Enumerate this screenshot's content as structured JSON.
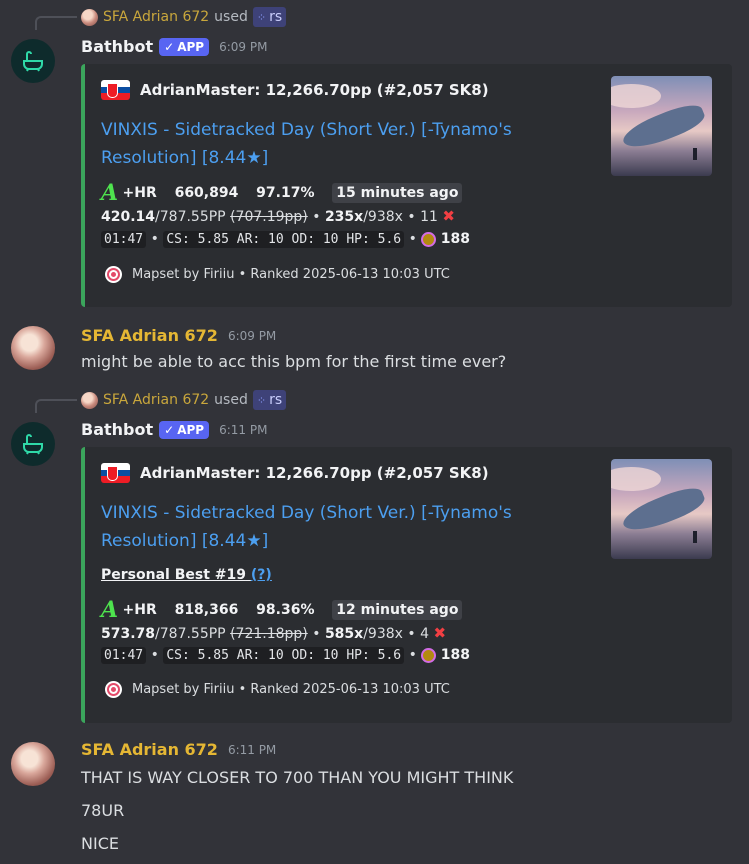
{
  "messages": [
    {
      "reply": {
        "user": "SFA Adrian 672",
        "used": "used",
        "command": "rs"
      },
      "bot": {
        "name": "Bathbot",
        "badge": "APP",
        "time": "6:09 PM"
      },
      "embed": {
        "author": "AdrianMaster: 12,266.70pp (#2,057 SK8)",
        "title": "VINXIS - Sidetracked Day (Short Ver.) [-Tynamo's Resolution] [8.44★]",
        "grade": "A",
        "mods": "+HR",
        "score": "660,894",
        "accuracy": "97.17%",
        "time_ago": "15 minutes ago",
        "pp": "420.14",
        "pp_max": "/787.55PP",
        "pp_fc": "(707.19pp)",
        "combo": "235x",
        "combo_max": "/938x",
        "misses": "11",
        "length": "01:47",
        "map_stats": "CS: 5.85 AR: 10 OD: 10 HP: 5.6",
        "bpm": "188",
        "footer": "Mapset by Firiiu • Ranked 2025-06-13 10:03 UTC"
      }
    },
    {
      "user": {
        "name": "SFA Adrian 672",
        "time": "6:09 PM"
      },
      "lines": [
        "might be able to acc this bpm for the first time ever?"
      ]
    },
    {
      "reply": {
        "user": "SFA Adrian 672",
        "used": "used",
        "command": "rs"
      },
      "bot": {
        "name": "Bathbot",
        "badge": "APP",
        "time": "6:11 PM"
      },
      "embed": {
        "author": "AdrianMaster: 12,266.70pp (#2,057 SK8)",
        "title": "VINXIS - Sidetracked Day (Short Ver.) [-Tynamo's Resolution] [8.44★]",
        "personal_best": "Personal Best #19",
        "pb_link": "(?)",
        "grade": "A",
        "mods": "+HR",
        "score": "818,366",
        "accuracy": "98.36%",
        "time_ago": "12 minutes ago",
        "pp": "573.78",
        "pp_max": "/787.55PP",
        "pp_fc": "(721.18pp)",
        "combo": "585x",
        "combo_max": "/938x",
        "misses": "4",
        "length": "01:47",
        "map_stats": "CS: 5.85 AR: 10 OD: 10 HP: 5.6",
        "bpm": "188",
        "footer": "Mapset by Firiiu • Ranked 2025-06-13 10:03 UTC"
      }
    },
    {
      "user": {
        "name": "SFA Adrian 672",
        "time": "6:11 PM"
      },
      "lines": [
        "THAT IS WAY CLOSER TO 700 THAN YOU MIGHT THINK",
        "78UR",
        "NICE"
      ]
    }
  ],
  "colors": {
    "background": "#323339",
    "embed_bar": "#3ba55c",
    "link": "#4c9ff0",
    "user_name": "#e5b734",
    "app_badge": "#5865f2"
  },
  "icons": [
    "bathtub-icon",
    "checkmark-icon",
    "slash-command-icon",
    "flag-slovakia-icon",
    "osu-icon",
    "lazer-icon",
    "miss-x-icon"
  ]
}
